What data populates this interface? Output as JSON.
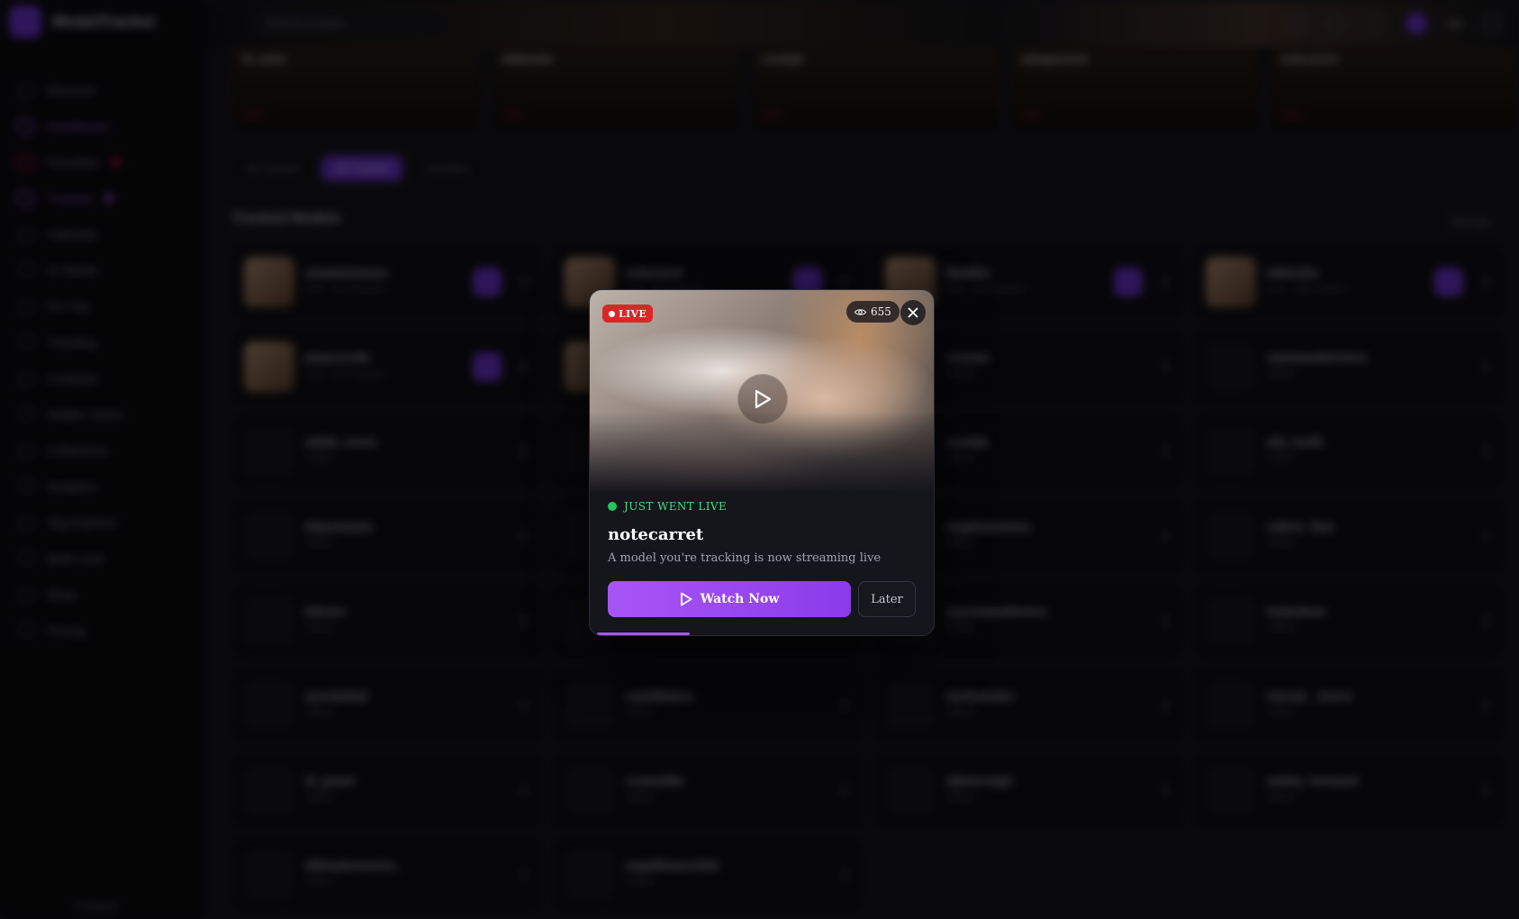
{
  "app": {
    "brand": "ModelTracker",
    "search_placeholder": "Search models...",
    "sidebar": [
      {
        "label": "Discover",
        "style": ""
      },
      {
        "label": "Dashboard",
        "style": "accent"
      },
      {
        "label": "Favorites",
        "style": "red"
      },
      {
        "label": "Tracked",
        "style": "accent"
      },
      {
        "label": "Calendar",
        "style": ""
      },
      {
        "label": "AI Studio",
        "style": ""
      },
      {
        "label": "For You",
        "style": ""
      },
      {
        "label": "Trending",
        "style": ""
      },
      {
        "label": "Compare",
        "style": ""
      },
      {
        "label": "Hidden Gems",
        "style": ""
      },
      {
        "label": "Collections",
        "style": ""
      },
      {
        "label": "Analytics",
        "style": ""
      },
      {
        "label": "Tag Explorer",
        "style": ""
      },
      {
        "label": "Multi-Cam",
        "style": ""
      },
      {
        "label": "Shop",
        "style": ""
      },
      {
        "label": "Pricing",
        "style": ""
      }
    ],
    "sidebar_footer": "Collapse",
    "user_label": "Me",
    "featured": [
      {
        "name": "lil_amie",
        "live": "Live"
      },
      {
        "name": "ddduckie",
        "live": "Live"
      },
      {
        "name": "coralyb",
        "live": "Live"
      },
      {
        "name": "elaiajaxxout",
        "live": "Live"
      },
      {
        "name": "notecarret",
        "live": "Live"
      }
    ],
    "filters": [
      "All Tracked",
      "All Tracked",
      "Favorites"
    ],
    "section_title": "Tracked Models",
    "section_link": "Manage",
    "models": [
      {
        "name": "amaiamenezes",
        "sub": "Live · 421 viewers",
        "live": true,
        "photo": true
      },
      {
        "name": "notecarret",
        "sub": "Live · 655 viewers",
        "live": true,
        "photo": true
      },
      {
        "name": "lilyallbu",
        "sub": "Live · 312 viewers",
        "live": true,
        "photo": true
      },
      {
        "name": "ddduckie",
        "sub": "Live · 188 viewers",
        "live": true,
        "photo": true
      },
      {
        "name": "pinacocolla",
        "sub": "Live · 241 viewers",
        "live": true,
        "photo": true
      },
      {
        "name": "",
        "sub": "",
        "live": false,
        "photo": true
      },
      {
        "name": "orsonia",
        "sub": "Offline",
        "live": false,
        "photo": false
      },
      {
        "name": "saintsandwichess",
        "sub": "Offline",
        "live": false,
        "photo": false
      },
      {
        "name": "adelle_moon",
        "sub": "Offline",
        "live": false,
        "photo": false
      },
      {
        "name": "",
        "sub": "",
        "live": false,
        "photo": false
      },
      {
        "name": "coralyb",
        "sub": "Offline",
        "live": false,
        "photo": false
      },
      {
        "name": "ella_lux55",
        "sub": "Offline",
        "live": false,
        "photo": false
      },
      {
        "name": "bittysmacks",
        "sub": "Offline",
        "live": false,
        "photo": false
      },
      {
        "name": "",
        "sub": "",
        "live": false,
        "photo": false
      },
      {
        "name": "angelsvenenos",
        "sub": "Offline",
        "live": false,
        "photo": false
      },
      {
        "name": "valkrie_flow",
        "sub": "Offline",
        "live": false,
        "photo": false
      },
      {
        "name": "biloxen",
        "sub": "Offline",
        "live": false,
        "photo": false
      },
      {
        "name": "",
        "sub": "",
        "live": false,
        "photo": false
      },
      {
        "name": "yourssweetlovexx",
        "sub": "Offline",
        "live": false,
        "photo": false
      },
      {
        "name": "lindaxbeat",
        "sub": "Offline",
        "live": false,
        "photo": false
      },
      {
        "name": "aerodobla3",
        "sub": "Offline",
        "live": false,
        "photo": false
      },
      {
        "name": "candilhiarra",
        "sub": "Offline",
        "live": false,
        "photo": false
      },
      {
        "name": "devlinandee",
        "sub": "Offline",
        "live": false,
        "photo": false
      },
      {
        "name": "eternal__lovers",
        "sub": "Offline",
        "live": false,
        "photo": false
      },
      {
        "name": "lit_grand",
        "sub": "Offline",
        "live": false,
        "photo": false
      },
      {
        "name": "roxiemillie",
        "sub": "Offline",
        "live": false,
        "photo": false
      },
      {
        "name": "allielorraigh",
        "sub": "Offline",
        "live": false,
        "photo": false
      },
      {
        "name": "ashley_honeyed",
        "sub": "Offline",
        "live": false,
        "photo": false
      },
      {
        "name": "tiffanykensonna_",
        "sub": "Offline",
        "live": false,
        "photo": false
      },
      {
        "name": "angelflowerchild",
        "sub": "Offline",
        "live": false,
        "photo": false
      }
    ]
  },
  "modal": {
    "live_badge": "LIVE",
    "viewers": "655",
    "status": "JUST WENT LIVE",
    "model_name": "notecarret",
    "description": "A model you're tracking is now streaming live",
    "watch_label": "Watch Now",
    "later_label": "Later",
    "progress_fraction": 0.28,
    "colors": {
      "accent": "#a855f7",
      "live_red": "#dc2626",
      "status_green": "#22c55e"
    }
  }
}
